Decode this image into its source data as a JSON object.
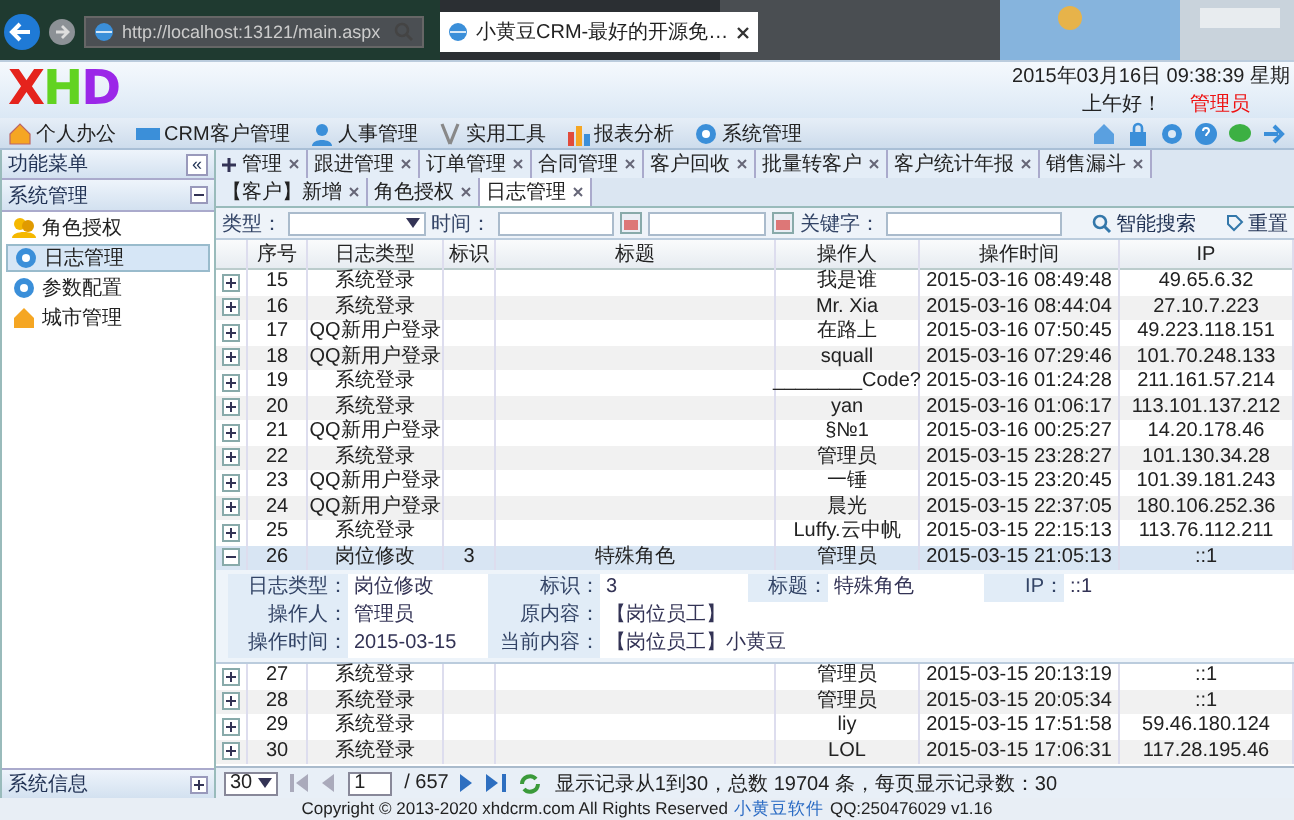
{
  "browser": {
    "url": "http://localhost:13121/main.aspx",
    "tab_title": "小黄豆CRM-最好的开源免…"
  },
  "header": {
    "logo": "XHD",
    "datetime": "2015年03月16日 09:38:39 星期",
    "greeting": "上午好！",
    "user": "管理员"
  },
  "menu": [
    {
      "label": "个人办公"
    },
    {
      "label": "CRM客户管理"
    },
    {
      "label": "人事管理"
    },
    {
      "label": "实用工具"
    },
    {
      "label": "报表分析"
    },
    {
      "label": "系统管理"
    }
  ],
  "sidebar": {
    "title": "功能菜单",
    "collapse": "«",
    "group": "系统管理",
    "items": [
      {
        "label": "角色授权",
        "selected": false
      },
      {
        "label": "日志管理",
        "selected": true
      },
      {
        "label": "参数配置",
        "selected": false
      },
      {
        "label": "城市管理",
        "selected": false
      }
    ],
    "footer": "系统信息"
  },
  "tabs": [
    {
      "label": "管理",
      "selected": false
    },
    {
      "label": "跟进管理",
      "selected": false
    },
    {
      "label": "订单管理",
      "selected": false
    },
    {
      "label": "合同管理",
      "selected": false
    },
    {
      "label": "客户回收",
      "selected": false
    },
    {
      "label": "批量转客户",
      "selected": false
    },
    {
      "label": "客户统计年报",
      "selected": false
    },
    {
      "label": "销售漏斗",
      "selected": false
    },
    {
      "label": "【客户】新增",
      "selected": false
    },
    {
      "label": "角色授权",
      "selected": false
    },
    {
      "label": "日志管理",
      "selected": true
    }
  ],
  "filter": {
    "type_label": "类型：",
    "time_label": "时间：",
    "keyword_label": "关键字：",
    "search": "智能搜索",
    "reset": "重置"
  },
  "table": {
    "columns": [
      "序号",
      "日志类型",
      "标识",
      "标题",
      "操作人",
      "操作时间",
      "IP"
    ],
    "rows": [
      {
        "cells": [
          "15",
          "系统登录",
          "",
          "",
          "我是谁",
          "2015-03-16 08:49:48",
          "49.65.6.32"
        ],
        "expanded": false
      },
      {
        "cells": [
          "16",
          "系统登录",
          "",
          "",
          "Mr. Xia",
          "2015-03-16 08:44:04",
          "27.10.7.223"
        ],
        "expanded": false
      },
      {
        "cells": [
          "17",
          "QQ新用户登录",
          "",
          "",
          "在路上",
          "2015-03-16 07:50:45",
          "49.223.118.151"
        ],
        "expanded": false
      },
      {
        "cells": [
          "18",
          "QQ新用户登录",
          "",
          "",
          "squall",
          "2015-03-16 07:29:46",
          "101.70.248.133"
        ],
        "expanded": false
      },
      {
        "cells": [
          "19",
          "系统登录",
          "",
          "",
          "________Code?",
          "2015-03-16 01:24:28",
          "211.161.57.214"
        ],
        "expanded": false
      },
      {
        "cells": [
          "20",
          "系统登录",
          "",
          "",
          "yan",
          "2015-03-16 01:06:17",
          "113.101.137.212"
        ],
        "expanded": false
      },
      {
        "cells": [
          "21",
          "QQ新用户登录",
          "",
          "",
          "§№1",
          "2015-03-16 00:25:27",
          "14.20.178.46"
        ],
        "expanded": false
      },
      {
        "cells": [
          "22",
          "系统登录",
          "",
          "",
          "管理员",
          "2015-03-15 23:28:27",
          "101.130.34.28"
        ],
        "expanded": false
      },
      {
        "cells": [
          "23",
          "QQ新用户登录",
          "",
          "",
          "一锤",
          "2015-03-15 23:20:45",
          "101.39.181.243"
        ],
        "expanded": false
      },
      {
        "cells": [
          "24",
          "QQ新用户登录",
          "",
          "",
          "晨光",
          "2015-03-15 22:37:05",
          "180.106.252.36"
        ],
        "expanded": false
      },
      {
        "cells": [
          "25",
          "系统登录",
          "",
          "",
          "Luffy.云中帆",
          "2015-03-15 22:15:13",
          "113.76.112.211"
        ],
        "expanded": false
      },
      {
        "cells": [
          "26",
          "岗位修改",
          "3",
          "特殊角色",
          "管理员",
          "2015-03-15 21:05:13",
          "::1"
        ],
        "expanded": true,
        "detail": [
          [
            {
              "label": "日志类型：",
              "value": "岗位修改"
            },
            {
              "label": "标识：",
              "value": "3"
            },
            {
              "label": "标题：",
              "value": "特殊角色"
            },
            {
              "label": "IP：",
              "value": "::1"
            }
          ],
          [
            {
              "label": "操作人：",
              "value": "管理员"
            },
            {
              "label": "原内容：",
              "value": "【岗位员工】"
            }
          ],
          [
            {
              "label": "操作时间：",
              "value": "2015-03-15"
            },
            {
              "label": "当前内容：",
              "value": "【岗位员工】小黄豆"
            }
          ]
        ]
      },
      {
        "cells": [
          "27",
          "系统登录",
          "",
          "",
          "管理员",
          "2015-03-15 20:13:19",
          "::1"
        ],
        "expanded": false
      },
      {
        "cells": [
          "28",
          "系统登录",
          "",
          "",
          "管理员",
          "2015-03-15 20:05:34",
          "::1"
        ],
        "expanded": false
      },
      {
        "cells": [
          "29",
          "系统登录",
          "",
          "",
          "liy",
          "2015-03-15 17:51:58",
          "59.46.180.124"
        ],
        "expanded": false
      },
      {
        "cells": [
          "30",
          "系统登录",
          "",
          "",
          "LOL",
          "2015-03-15 17:06:31",
          "117.28.195.46"
        ],
        "expanded": false
      }
    ]
  },
  "pager": {
    "page_size": "30",
    "page": "1",
    "total_pages": "/ 657",
    "summary": "显示记录从1到30，总数 19704 条，每页显示记录数：30"
  },
  "footer": {
    "text": "Copyright © 2013-2020 xhdcrm.com All Rights Reserved",
    "link": "小黄豆软件",
    "version": "QQ:250476029 v1.16"
  }
}
